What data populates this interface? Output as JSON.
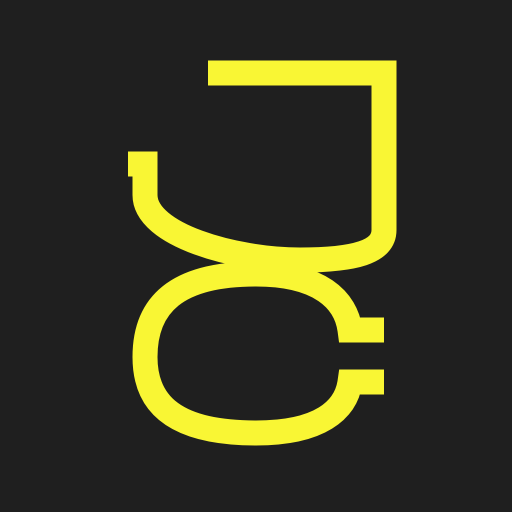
{
  "logo": {
    "text": "JC",
    "icon": "jc-monogram-icon"
  },
  "colors": {
    "background": "#1f1f1f",
    "accent": "#f9f634"
  }
}
